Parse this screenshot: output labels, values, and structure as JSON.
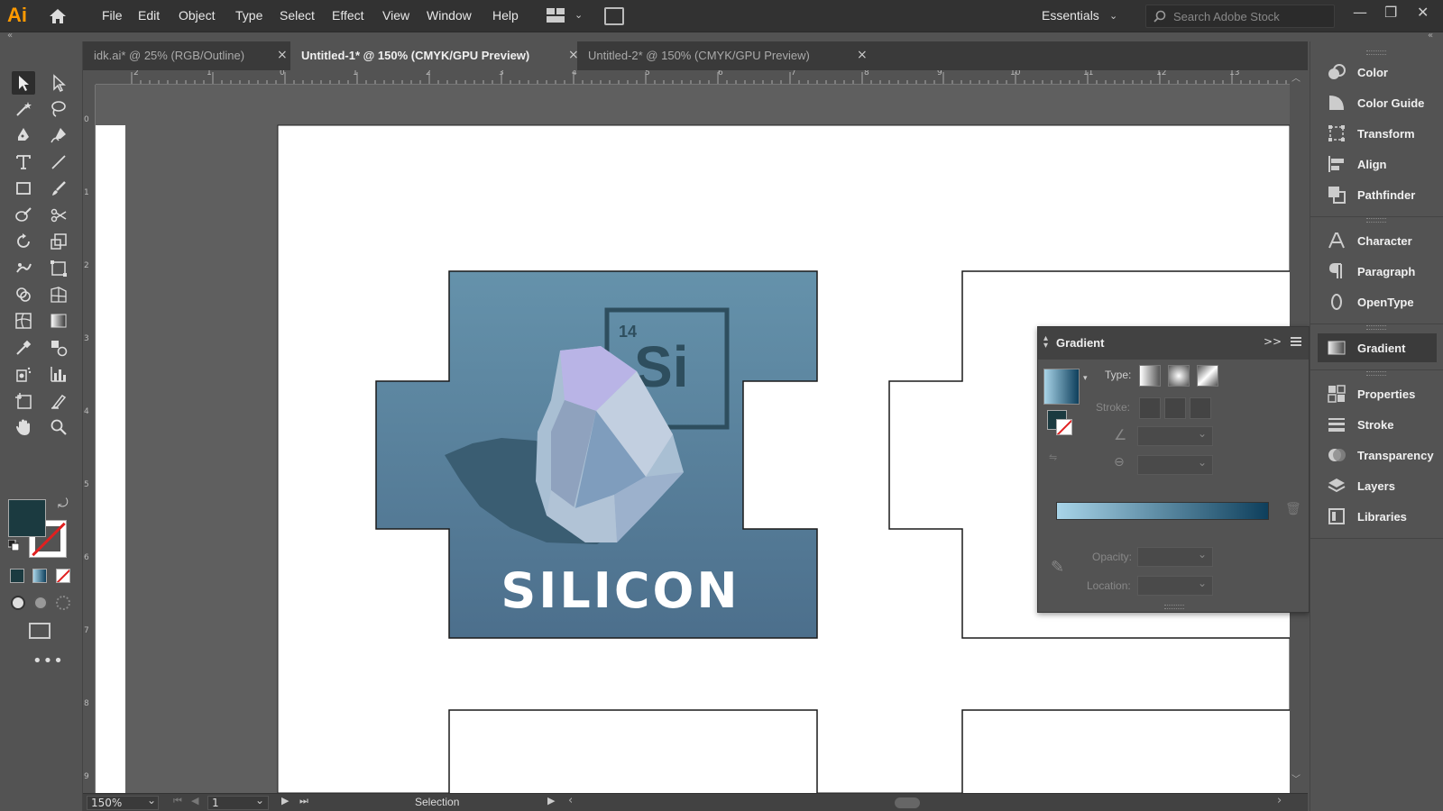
{
  "app": {
    "logo": "Ai"
  },
  "menu": [
    "File",
    "Edit",
    "Object",
    "Type",
    "Select",
    "Effect",
    "View",
    "Window",
    "Help"
  ],
  "workspace": {
    "label": "Essentials"
  },
  "search": {
    "placeholder": "Search Adobe Stock"
  },
  "tabs": [
    {
      "label": "idk.ai* @ 25% (RGB/Outline)",
      "active": false
    },
    {
      "label": "Untitled-1* @ 150% (CMYK/GPU Preview)",
      "active": true
    },
    {
      "label": "Untitled-2* @ 150% (CMYK/GPU Preview)",
      "active": false
    }
  ],
  "ruler": {
    "top": [
      "2",
      "1",
      "0",
      "1",
      "2",
      "3",
      "4",
      "5",
      "6",
      "7",
      "8",
      "9",
      "10",
      "11",
      "12",
      "13"
    ],
    "left": [
      "0",
      "1",
      "2",
      "3",
      "4",
      "5",
      "6",
      "7",
      "8",
      "9"
    ]
  },
  "artwork": {
    "element_number": "14",
    "element_symbol": "Si",
    "title": "SILICON",
    "colors": {
      "top": "#6592ab",
      "bottom": "#4c6f8c",
      "dark": "#2e4e5e",
      "stroke": "#1a1a1a"
    }
  },
  "colors": {
    "fill": "#1b3a40",
    "accent": "#ff9a00"
  },
  "right_panel": {
    "group1": [
      "Color",
      "Color Guide",
      "Transform",
      "Align",
      "Pathfinder"
    ],
    "group2": [
      "Character",
      "Paragraph",
      "OpenType"
    ],
    "group3": [
      "Gradient"
    ],
    "group4": [
      "Properties",
      "Stroke",
      "Transparency",
      "Layers",
      "Libraries"
    ]
  },
  "gradient_panel": {
    "title": "Gradient",
    "type_label": "Type:",
    "stroke_label": "Stroke:",
    "opacity_label": "Opacity:",
    "location_label": "Location:",
    "gradient_start": "#a8d4e8",
    "gradient_end": "#0e3f5c"
  },
  "status": {
    "zoom": "150%",
    "artboard": "1",
    "tool": "Selection"
  }
}
